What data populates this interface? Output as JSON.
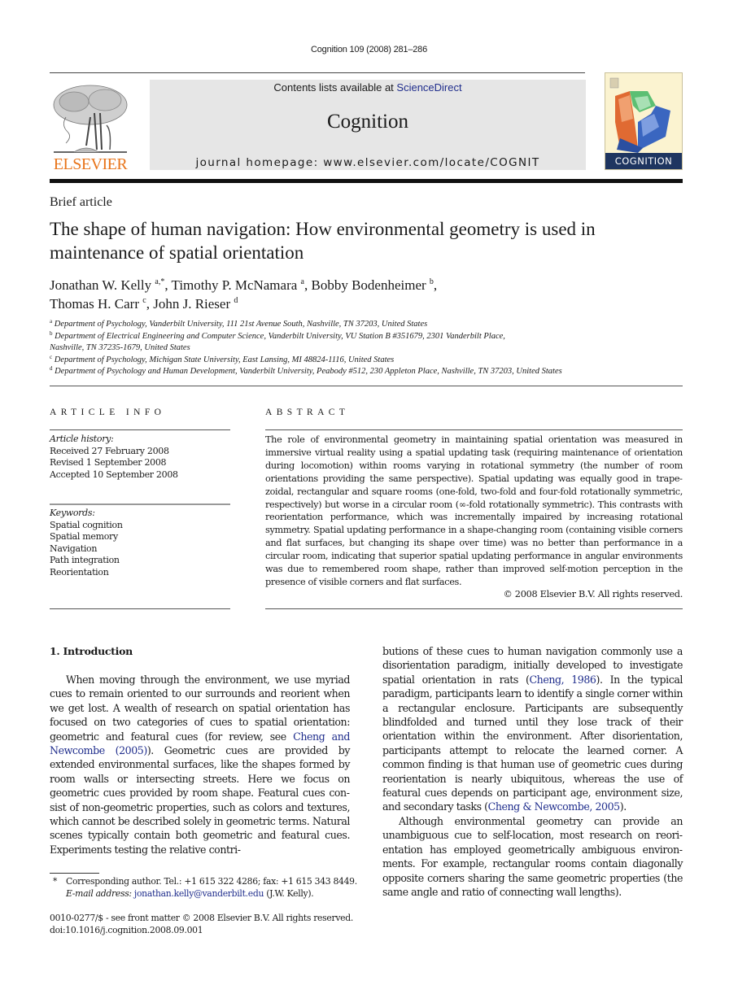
{
  "journal_ref": "Cognition 109 (2008) 281–286",
  "header": {
    "contents_prefix": "Contents lists available at ",
    "contents_link": "ScienceDirect",
    "journal_name": "Cognition",
    "homepage": "journal homepage: www.elsevier.com/locate/COGNIT",
    "publisher_logo_text": "ELSEVIER",
    "cover_title": "COGNITION",
    "colors": {
      "publisher_orange": "#e8741a",
      "link_blue": "#1f2d8c",
      "header_box": "#e6e6e6",
      "cover_band": "#1e3560"
    }
  },
  "article": {
    "type": "Brief article",
    "title": "The shape of human navigation: How environmental geometry is used in maintenance of spatial orientation",
    "authors": [
      {
        "name": "Jonathan W. Kelly",
        "aff": "a,*",
        "sep": ", "
      },
      {
        "name": "Timothy P. McNamara",
        "aff": "a",
        "sep": ", "
      },
      {
        "name": "Bobby Bodenheimer",
        "aff": "b",
        "sep": ","
      },
      {
        "name": "Thomas H. Carr",
        "aff": "c",
        "sep": ", "
      },
      {
        "name": "John J. Rieser",
        "aff": "d",
        "sep": ""
      }
    ],
    "affiliations": [
      {
        "mark": "a",
        "text": "Department of Psychology, Vanderbilt University, 111 21st Avenue South, Nashville, TN 37203, United States"
      },
      {
        "mark": "b",
        "text": "Department of Electrical Engineering and Computer Science, Vanderbilt University, VU Station B #351679, 2301 Vanderbilt Place,",
        "text2": "Nashville, TN 37235-1679, United States"
      },
      {
        "mark": "c",
        "text": "Department of Psychology, Michigan State University, East Lansing, MI 48824-1116, United States"
      },
      {
        "mark": "d",
        "text": "Department of Psychology and Human Development, Vanderbilt University, Peabody #512, 230 Appleton Place, Nashville, TN 37203, United States"
      }
    ]
  },
  "article_info": {
    "heading": "ARTICLE INFO",
    "history_label": "Article history:",
    "history": [
      "Received 27 February 2008",
      "Revised 1 September 2008",
      "Accepted 10 September 2008"
    ],
    "keywords_label": "Keywords:",
    "keywords": [
      "Spatial cognition",
      "Spatial memory",
      "Navigation",
      "Path integration",
      "Reorientation"
    ]
  },
  "abstract": {
    "heading": "ABSTRACT",
    "text": "The role of environmental geometry in maintaining spatial orientation was measured in immersive virtual reality using a spatial updating task (requiring maintenance of orienta­tion during locomotion) within rooms varying in rotational symmetry (the number of room orientations providing the same perspective). Spatial updating was equally good in trape­zoidal, rectangular and square rooms (one-fold, two-fold and four-fold rotationally sym­metric, respectively) but worse in a circular room (∞-fold rotationally symmetric). This contrasts with reorientation performance, which was incrementally impaired by increasing rotational symmetry. Spatial updating performance in a shape-changing room (containing visible corners and flat surfaces, but changing its shape over time) was no better than per­formance in a circular room, indicating that superior spatial updating performance in angu­lar environments was due to remembered room shape, rather than improved self-motion perception in the presence of visible corners and flat surfaces.",
    "copyright": "© 2008 Elsevier B.V. All rights reserved."
  },
  "body": {
    "section_heading": "1.  Introduction",
    "left_p1_a": "When moving through the environment, we use myriad cues to remain oriented to our surrounds and reorient when we get lost. A wealth of research on spatial orienta­tion has focused on two categories of cues to spatial orien­tation: geometric and featural cues (for review, see ",
    "left_p1_link": "Cheng and Newcombe (2005)",
    "left_p1_b": "). Geometric cues are provided by extended environmental surfaces, like the shapes formed by room walls or intersecting streets. Here we focus on geometric cues provided by room shape. Featural cues con­sist of non-geometric properties, such as colors and tex­tures, which cannot be described solely in geometric terms. Natural scenes typically contain both geometric and featural cues. Experiments testing the relative contri-",
    "right_p1_a": "butions of these cues to human navigation commonly use a disorientation paradigm, initially developed to investi­gate spatial orientation in rats (",
    "right_p1_link1": "Cheng, 1986",
    "right_p1_b": "). In the typical paradigm, participants learn to identify a single corner within a rectangular enclosure. Participants are subse­quently blindfolded and turned until they lose track of their orientation within the environment. After disorienta­tion, participants attempt to relocate the learned corner. A common finding is that human use of geometric cues dur­ing reorientation is nearly ubiquitous, whereas the use of featural cues depends on participant age, environment size, and secondary tasks (",
    "right_p1_link2": "Cheng & Newcombe, 2005",
    "right_p1_c": ").",
    "right_p2": "Although environmental geometry can provide an unambiguous cue to self-location, most research on reori­entation has employed geometrically ambiguous environ­ments. For example, rectangular rooms contain diagonally opposite corners sharing the same geometric properties (the same angle and ratio of connecting wall lengths)."
  },
  "footnotes": {
    "star": "*",
    "corresponding": "Corresponding author. Tel.: +1 615 322 4286; fax: +1 615 343 8449.",
    "email_label": "E-mail address:",
    "email": "jonathan.kelly@vanderbilt.edu",
    "email_suffix": " (J.W. Kelly).",
    "front_matter": "0010-0277/$ - see front matter © 2008 Elsevier B.V. All rights reserved.",
    "doi": "doi:10.1016/j.cognition.2008.09.001"
  }
}
